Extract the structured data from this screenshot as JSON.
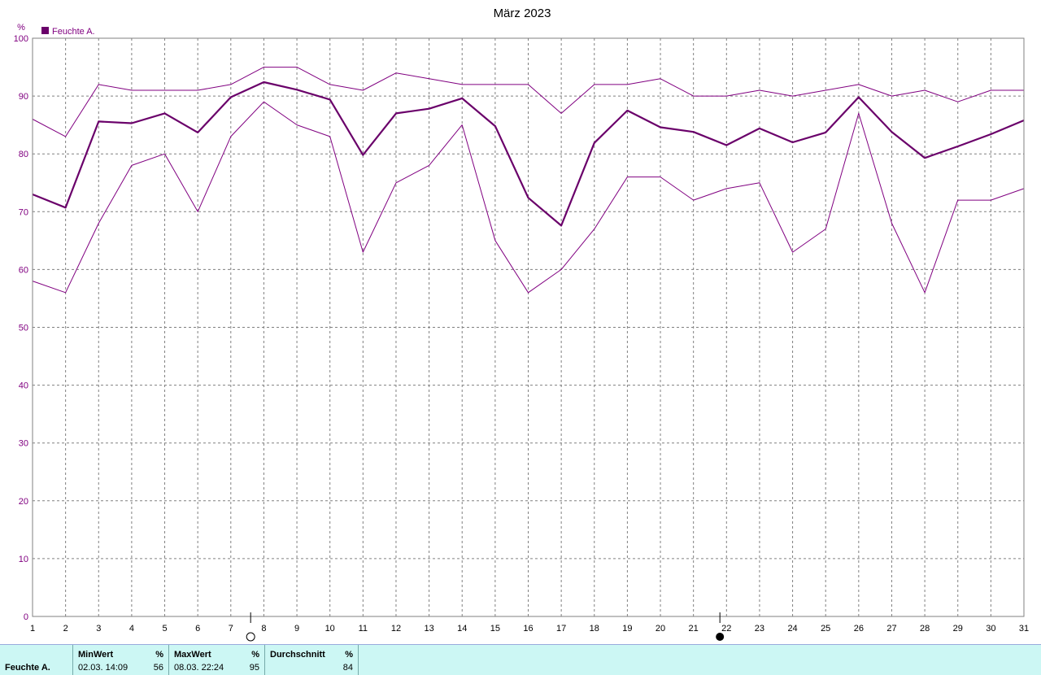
{
  "chart_data": {
    "type": "line",
    "title": "März 2023",
    "ylabel": "%",
    "legend": {
      "label": "Feuchte A.",
      "placement": "top-left",
      "color": "#6a006a"
    },
    "ylim": [
      0,
      100
    ],
    "yticks": [
      0,
      10,
      20,
      30,
      40,
      50,
      60,
      70,
      80,
      90,
      100
    ],
    "x": [
      1,
      2,
      3,
      4,
      5,
      6,
      7,
      8,
      9,
      10,
      11,
      12,
      13,
      14,
      15,
      16,
      17,
      18,
      19,
      20,
      21,
      22,
      23,
      24,
      25,
      26,
      27,
      28,
      29,
      30,
      31
    ],
    "grid": true,
    "series": [
      {
        "name": "Feuchte A.",
        "color": "#6a006a",
        "values": [
          73,
          70.7,
          85.6,
          85.3,
          87,
          83.7,
          89.8,
          92.4,
          91.1,
          89.4,
          79.8,
          87,
          87.8,
          89.6,
          84.8,
          72.4,
          67.6,
          81.9,
          87.5,
          84.6,
          83.8,
          81.5,
          84.4,
          82,
          83.7,
          89.8,
          83.8,
          79.3,
          81.3,
          83.4,
          85.8
        ]
      },
      {
        "color": "#800080",
        "values": [
          86,
          83,
          92,
          91,
          91,
          91,
          92,
          95,
          95,
          92,
          91,
          94,
          93,
          92,
          92,
          92,
          87,
          92,
          92,
          93,
          90,
          90,
          91,
          90,
          91,
          92,
          90,
          91,
          89,
          91,
          91
        ]
      },
      {
        "color": "#800080",
        "values": [
          58,
          56,
          68,
          78,
          80,
          70,
          83,
          89,
          85,
          83,
          63,
          75,
          78,
          85,
          65,
          56,
          60,
          67,
          76,
          76,
          72,
          74,
          75,
          63,
          67,
          87,
          68,
          56,
          72,
          72,
          74
        ]
      }
    ],
    "moon_phases": [
      {
        "symbol": "full-moon",
        "day": 7.6
      },
      {
        "symbol": "new-moon",
        "day": 21.8
      }
    ]
  },
  "stats": {
    "row_label": "Feuchte A.",
    "min": {
      "label": "MinWert",
      "unit": "%",
      "datetime": "02.03.  14:09",
      "value": "56"
    },
    "max": {
      "label": "MaxWert",
      "unit": "%",
      "datetime": "08.03.  22:24",
      "value": "95"
    },
    "avg": {
      "label": "Durchschnitt",
      "unit": "%",
      "value": "84"
    }
  }
}
